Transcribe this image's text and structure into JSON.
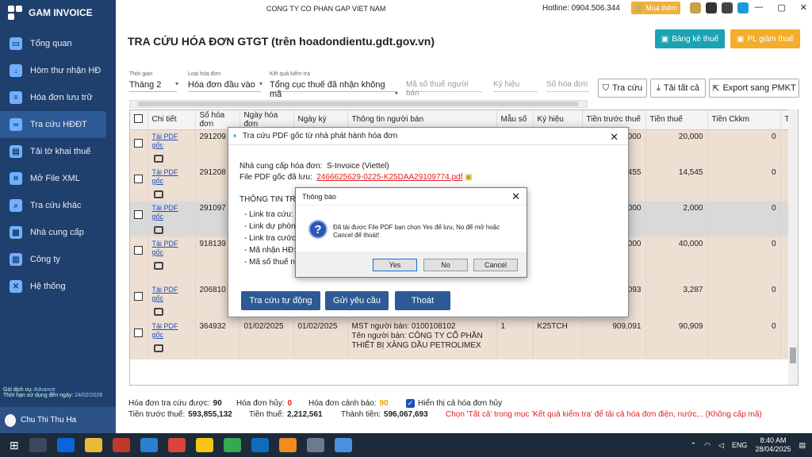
{
  "app": {
    "name": "GAM INVOICE"
  },
  "topbar": {
    "company": "CONG TY CO PHAN GAP VIET NAM",
    "hotline": "Hotline: 0904.506.344",
    "buy": "Mua thêm"
  },
  "sidebar": {
    "items": [
      {
        "label": "Tổng quan",
        "icon": "monitor-icon"
      },
      {
        "label": "Hòm thư nhận HĐ",
        "icon": "download-icon"
      },
      {
        "label": "Hóa đơn lưu trữ",
        "icon": "document-icon"
      },
      {
        "label": "Tra cứu HĐĐT",
        "icon": "link-icon"
      },
      {
        "label": "Tải tờ khai thuế",
        "icon": "file-icon"
      },
      {
        "label": "Mở File XML",
        "icon": "xml-icon"
      },
      {
        "label": "Tra cứu khác",
        "icon": "search-icon"
      },
      {
        "label": "Nhà cung cấp",
        "icon": "contacts-icon"
      },
      {
        "label": "Công ty",
        "icon": "building-icon"
      },
      {
        "label": "Hệ thống",
        "icon": "tools-icon"
      }
    ],
    "plan_label": "Gói dịch vụ:",
    "plan_value": "Advance",
    "expiry_label": "Thời hạn sử dụng đến ngày:",
    "expiry_value": "24/02/2026",
    "user": "Chu Thi Thu Ha"
  },
  "page": {
    "title": "TRA CỨU HÓA ĐƠN GTGT (trên hoadondientu.gdt.gov.vn)",
    "btn_bangke": "Bảng kê thuế",
    "btn_pl": "PL giảm thuế"
  },
  "filters": {
    "period_label": "Thời gian",
    "period_value": "Tháng 2",
    "type_label": "Loại hóa đơn",
    "type_value": "Hóa đơn đầu vào",
    "check_label": "Kết quả kiểm tra",
    "check_value": "Tổng cục thuế đã nhận không mã",
    "tax_ph": "Mã số thuế người bán",
    "symbol_ph": "Ký hiệu",
    "invno_ph": "Số hóa đơn",
    "btn_search": "Tra cứu",
    "btn_download": "Tải tất cả",
    "btn_export": "Export sang PMKT"
  },
  "table": {
    "headers": [
      "Chi tiết",
      "Số hóa đơn",
      "Ngày hóa đơn",
      "Ngày ký",
      "Thông tin người bán",
      "Mẫu số",
      "Ký hiệu",
      "Tiền trước thuế",
      "Tiền thuế",
      "Tiền Ckkm",
      "Tí"
    ],
    "link_label": "Tải PDF gốc",
    "rows": [
      {
        "so": "291209",
        "ngay": "",
        "ky": "",
        "nb": "",
        "mau": "",
        "kh": "",
        "truoc": "200,000",
        "thue": "20,000",
        "ck": "0"
      },
      {
        "so": "291208",
        "ngay": "",
        "ky": "",
        "nb": "",
        "mau": "",
        "kh": "",
        "truoc": "145,455",
        "thue": "14,545",
        "ck": "0"
      },
      {
        "so": "291097",
        "ngay": "",
        "ky": "",
        "nb": "",
        "mau": "",
        "kh": "",
        "truoc": "20,000",
        "thue": "2,000",
        "ck": "0"
      },
      {
        "so": "918139",
        "ngay": "",
        "ky": "",
        "nb": "",
        "mau": "",
        "kh": "",
        "truoc": "400,000",
        "thue": "40,000",
        "ck": "0"
      },
      {
        "so": "206810",
        "ngay": "",
        "ky": "",
        "nb": "",
        "mau": "",
        "kh": "",
        "truoc": "41,093",
        "thue": "3,287",
        "ck": "0"
      },
      {
        "so": "364932",
        "ngay": "01/02/2025",
        "ky": "01/02/2025",
        "nb": "MST người bán: 0100108102",
        "nb2": "Tên người bán: CÔNG TY CỔ PHẦN",
        "nb3": "THIẾT BỊ XĂNG DẦU PETROLIMEX",
        "mau": "1",
        "kh": "K25TCH",
        "truoc": "909,091",
        "thue": "90,909",
        "ck": "0"
      }
    ]
  },
  "status": {
    "searched_label": "Hóa đơn tra cứu được:",
    "searched": "90",
    "cancelled_label": "Hóa đơn hủy:",
    "cancelled": "0",
    "warn_label": "Hóa đơn cảnh báo:",
    "warn": "90",
    "show_cancel": "Hiển thị cả hóa đơn hủy",
    "pretax_label": "Tiền trước thuế:",
    "pretax": "593,855,132",
    "tax_label": "Tiền thuế:",
    "tax": "2,212,561",
    "total_label": "Thành tiền:",
    "total": "596,067,693",
    "hint": "Chọn 'Tất cả' trong mục 'Kết quả kiểm tra' để tải cả hóa đơn điện, nước,.. (Không cấp mã)"
  },
  "dialog": {
    "title": "Tra cứu PDF gốc từ nhà phát hành hóa đơn",
    "provider_label": "Nhà cung cấp hóa đơn:",
    "provider": "S-Invoice (Viettel)",
    "file_label": "File PDF gốc đã lưu:",
    "file": "2466625629-0225-K25DAA29109774.pdf",
    "info_title": "THÔNG TIN TRA",
    "lines": [
      "- Link tra cứu:",
      "- Link dự phòng",
      "- Link tra cước",
      "- Mã nhận HĐ:",
      "- Mã số thuế n"
    ],
    "btn_auto": "Tra cứu tự động",
    "btn_send": "Gửi yêu cầu",
    "btn_exit": "Thoát"
  },
  "msgbox": {
    "title": "Thông báo",
    "text": "Đã tải được File PDF bạn chọn Yes để lưu, No để mở hoặc Cancel để thoát!",
    "yes": "Yes",
    "no": "No",
    "cancel": "Cancel"
  },
  "taskbar": {
    "lang": "ENG",
    "time": "8:40 AM",
    "date": "28/04/2025"
  },
  "colors": {
    "sidebar": "#1f3f6d",
    "accent_teal": "#1ba3b3",
    "accent_orange": "#f3ad2b",
    "button_blue": "#2d5a95"
  }
}
